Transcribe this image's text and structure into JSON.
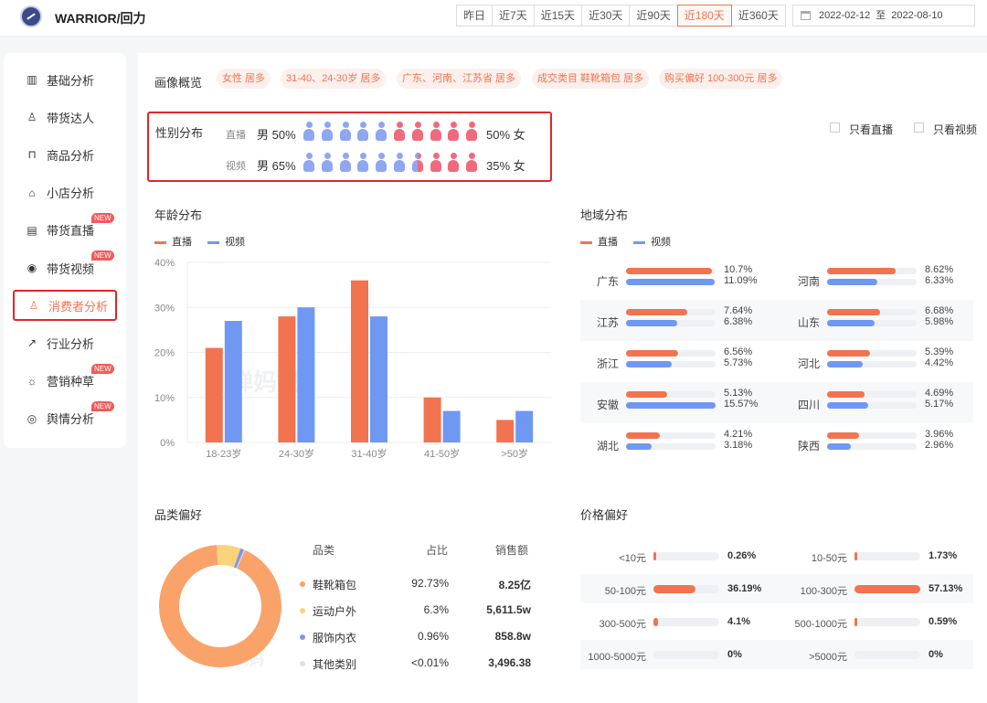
{
  "header": {
    "brand": "WARRIOR/回力",
    "range_tabs": [
      "昨日",
      "近7天",
      "近15天",
      "近30天",
      "近90天",
      "近180天",
      "近360天"
    ],
    "active_range": "近180天",
    "date_start": "2022-02-12",
    "date_sep": "至",
    "date_end": "2022-08-10"
  },
  "sidebar": {
    "items": [
      {
        "label": "基础分析",
        "icon": "bar-chart-icon",
        "new": false
      },
      {
        "label": "带货达人",
        "icon": "user-icon",
        "new": false
      },
      {
        "label": "商品分析",
        "icon": "bag-icon",
        "new": false
      },
      {
        "label": "小店分析",
        "icon": "store-icon",
        "new": false
      },
      {
        "label": "带货直播",
        "icon": "live-icon",
        "new": true
      },
      {
        "label": "带货视频",
        "icon": "play-icon",
        "new": true
      },
      {
        "label": "消费者分析",
        "icon": "consumer-icon",
        "new": false,
        "active": true
      },
      {
        "label": "行业分析",
        "icon": "trend-icon",
        "new": false
      },
      {
        "label": "营销种草",
        "icon": "bulb-icon",
        "new": true
      },
      {
        "label": "舆情分析",
        "icon": "leaf-icon",
        "new": true
      }
    ],
    "new_label": "NEW"
  },
  "profile": {
    "title": "画像概览",
    "tags": [
      "女性 居多",
      "31-40、24-30岁 居多",
      "广东、河南、江苏省 居多",
      "成交类目 鞋靴箱包 居多",
      "购买偏好 100-300元 居多"
    ]
  },
  "gender": {
    "title": "性别分布",
    "rows": [
      {
        "label": "直播",
        "male": "男 50%",
        "female": "50% 女",
        "male_share": 0.5
      },
      {
        "label": "视频",
        "male": "男 65%",
        "female": "35% 女",
        "male_share": 0.65
      }
    ],
    "male_color": "#8fa6f0",
    "female_color": "#f06a7e",
    "filters": [
      "只看直播",
      "只看视频"
    ]
  },
  "age": {
    "title": "年龄分布",
    "legend": [
      "直播",
      "视频"
    ]
  },
  "region": {
    "title": "地域分布",
    "legend": [
      "直播",
      "视频"
    ],
    "items": [
      {
        "name": "广东",
        "live": "10.7%",
        "video": "11.09%",
        "live_v": 10.7,
        "video_v": 11.09
      },
      {
        "name": "河南",
        "live": "8.62%",
        "video": "6.33%",
        "live_v": 8.62,
        "video_v": 6.33
      },
      {
        "name": "江苏",
        "live": "7.64%",
        "video": "6.38%",
        "live_v": 7.64,
        "video_v": 6.38
      },
      {
        "name": "山东",
        "live": "6.68%",
        "video": "5.98%",
        "live_v": 6.68,
        "video_v": 5.98
      },
      {
        "name": "浙江",
        "live": "6.56%",
        "video": "5.73%",
        "live_v": 6.56,
        "video_v": 5.73
      },
      {
        "name": "河北",
        "live": "5.39%",
        "video": "4.42%",
        "live_v": 5.39,
        "video_v": 4.42
      },
      {
        "name": "安徽",
        "live": "5.13%",
        "video": "15.57%",
        "live_v": 5.13,
        "video_v": 15.57
      },
      {
        "name": "四川",
        "live": "4.69%",
        "video": "5.17%",
        "live_v": 4.69,
        "video_v": 5.17
      },
      {
        "name": "湖北",
        "live": "4.21%",
        "video": "3.18%",
        "live_v": 4.21,
        "video_v": 3.18
      },
      {
        "name": "陕西",
        "live": "3.96%",
        "video": "2.96%",
        "live_v": 3.96,
        "video_v": 2.96
      }
    ]
  },
  "category": {
    "title": "品类偏好",
    "headers": [
      "品类",
      "占比",
      "销售额"
    ],
    "rows": [
      {
        "name": "鞋靴箱包",
        "share": "92.73%",
        "sales": "8.25亿",
        "color": "#f9a36b",
        "v": 92.73
      },
      {
        "name": "运动户外",
        "share": "6.3%",
        "sales": "5,611.5w",
        "color": "#fbd37a",
        "v": 6.3
      },
      {
        "name": "服饰内衣",
        "share": "0.96%",
        "sales": "858.8w",
        "color": "#7e97ee",
        "v": 0.96
      },
      {
        "name": "其他类别",
        "share": "<0.01%",
        "sales": "3,496.38",
        "color": "#dcdfe6",
        "v": 0.01
      }
    ]
  },
  "price": {
    "title": "价格偏好",
    "items": [
      {
        "label": "<10元",
        "value": "0.26%",
        "v": 0.26
      },
      {
        "label": "10-50元",
        "value": "1.73%",
        "v": 1.73
      },
      {
        "label": "50-100元",
        "value": "36.19%",
        "v": 36.19
      },
      {
        "label": "100-300元",
        "value": "57.13%",
        "v": 57.13
      },
      {
        "label": "300-500元",
        "value": "4.1%",
        "v": 4.1
      },
      {
        "label": "500-1000元",
        "value": "0.59%",
        "v": 0.59
      },
      {
        "label": "1000-5000元",
        "value": "0%",
        "v": 0
      },
      {
        "label": ">5000元",
        "value": "0%",
        "v": 0
      }
    ]
  },
  "watermark": "蝉妈妈",
  "chart_data": {
    "type": "bar",
    "title": "年龄分布",
    "categories": [
      "18-23岁",
      "24-30岁",
      "31-40岁",
      "41-50岁",
      ">50岁"
    ],
    "series": [
      {
        "name": "直播",
        "color": "#f2734f",
        "values": [
          21,
          28,
          36,
          10,
          5
        ]
      },
      {
        "name": "视频",
        "color": "#6f98f3",
        "values": [
          27,
          30,
          28,
          7,
          7
        ]
      }
    ],
    "yticks": [
      "0%",
      "10%",
      "20%",
      "30%",
      "40%"
    ],
    "ylim": [
      0,
      40
    ],
    "grid": true,
    "legend": "top-left"
  }
}
